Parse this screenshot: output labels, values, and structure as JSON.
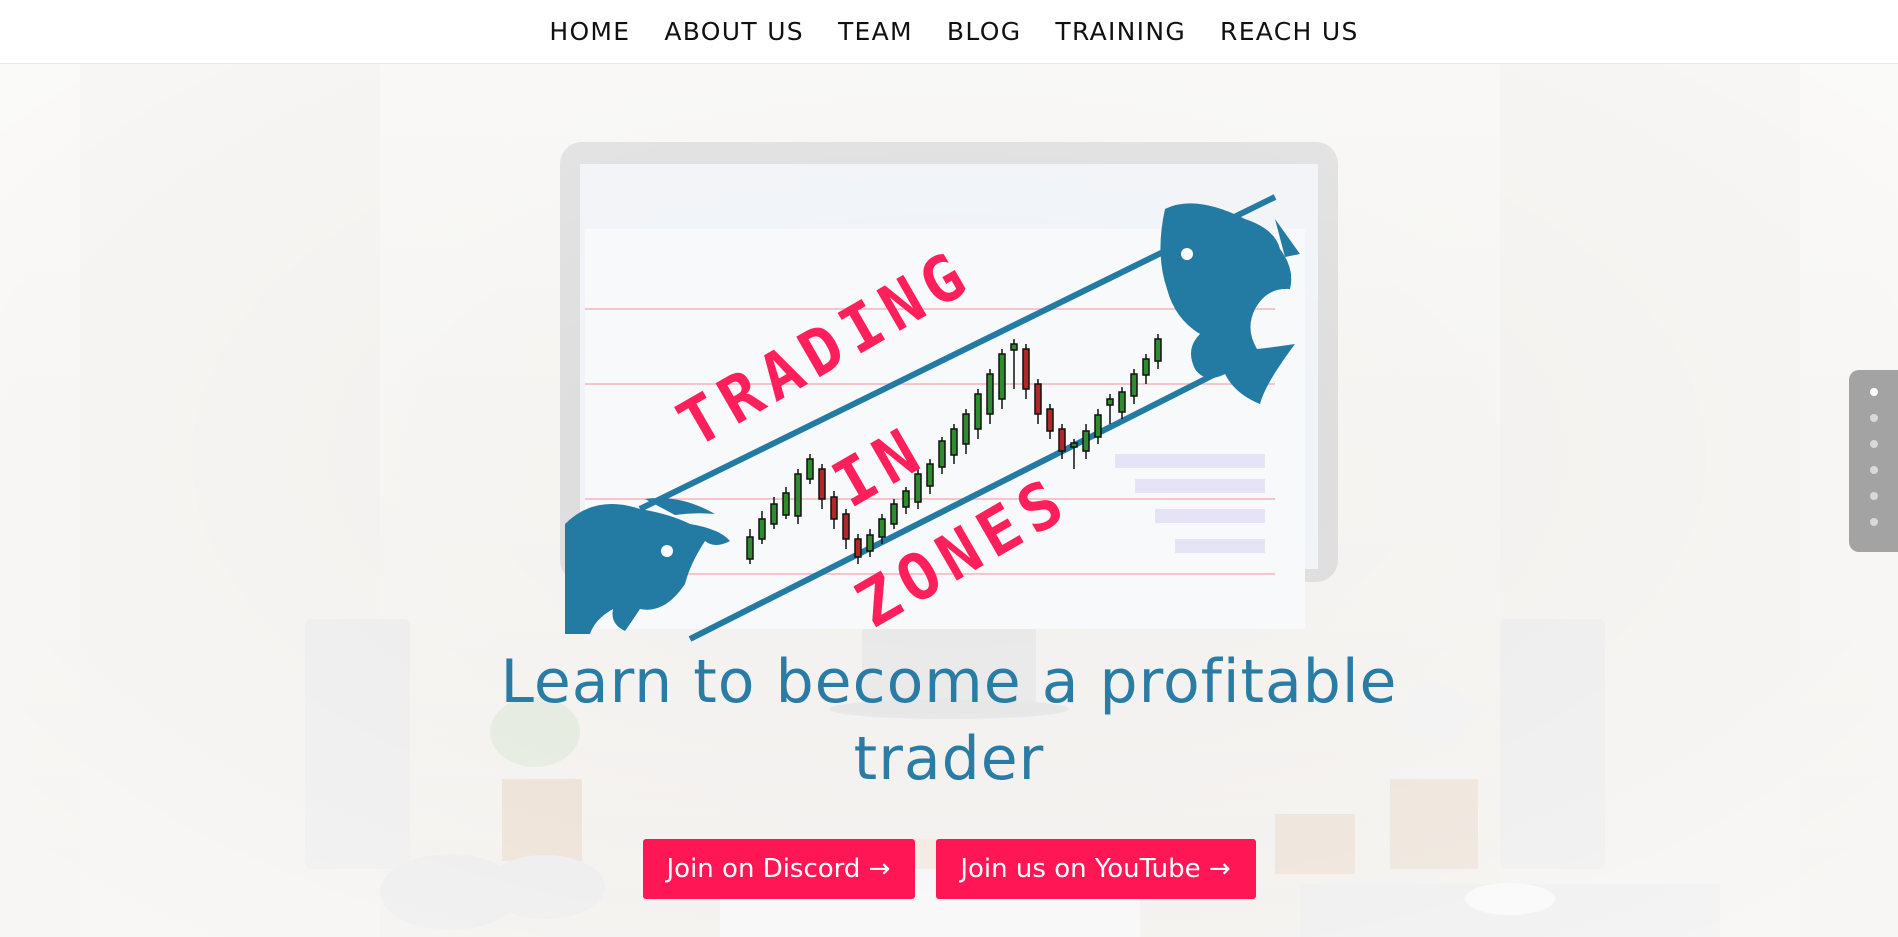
{
  "nav": {
    "items": [
      {
        "label": "HOME"
      },
      {
        "label": "ABOUT US"
      },
      {
        "label": "TEAM"
      },
      {
        "label": "BLOG"
      },
      {
        "label": "TRAINING"
      },
      {
        "label": "REACH US"
      }
    ]
  },
  "logo": {
    "line1": "TRADING",
    "line2": "IN",
    "line3": "ZONES",
    "text_color": "#ff1f5a",
    "channel_color": "#237aa3"
  },
  "hero": {
    "headline_line1": "Learn to become a profitable",
    "headline_line2": "trader",
    "headline_color": "#2a7ca5"
  },
  "cta": {
    "discord_label": "Join on Discord →",
    "youtube_label": "Join us on YouTube →",
    "color": "#ff1654"
  },
  "slider": {
    "active_index": 0,
    "total": 6
  }
}
